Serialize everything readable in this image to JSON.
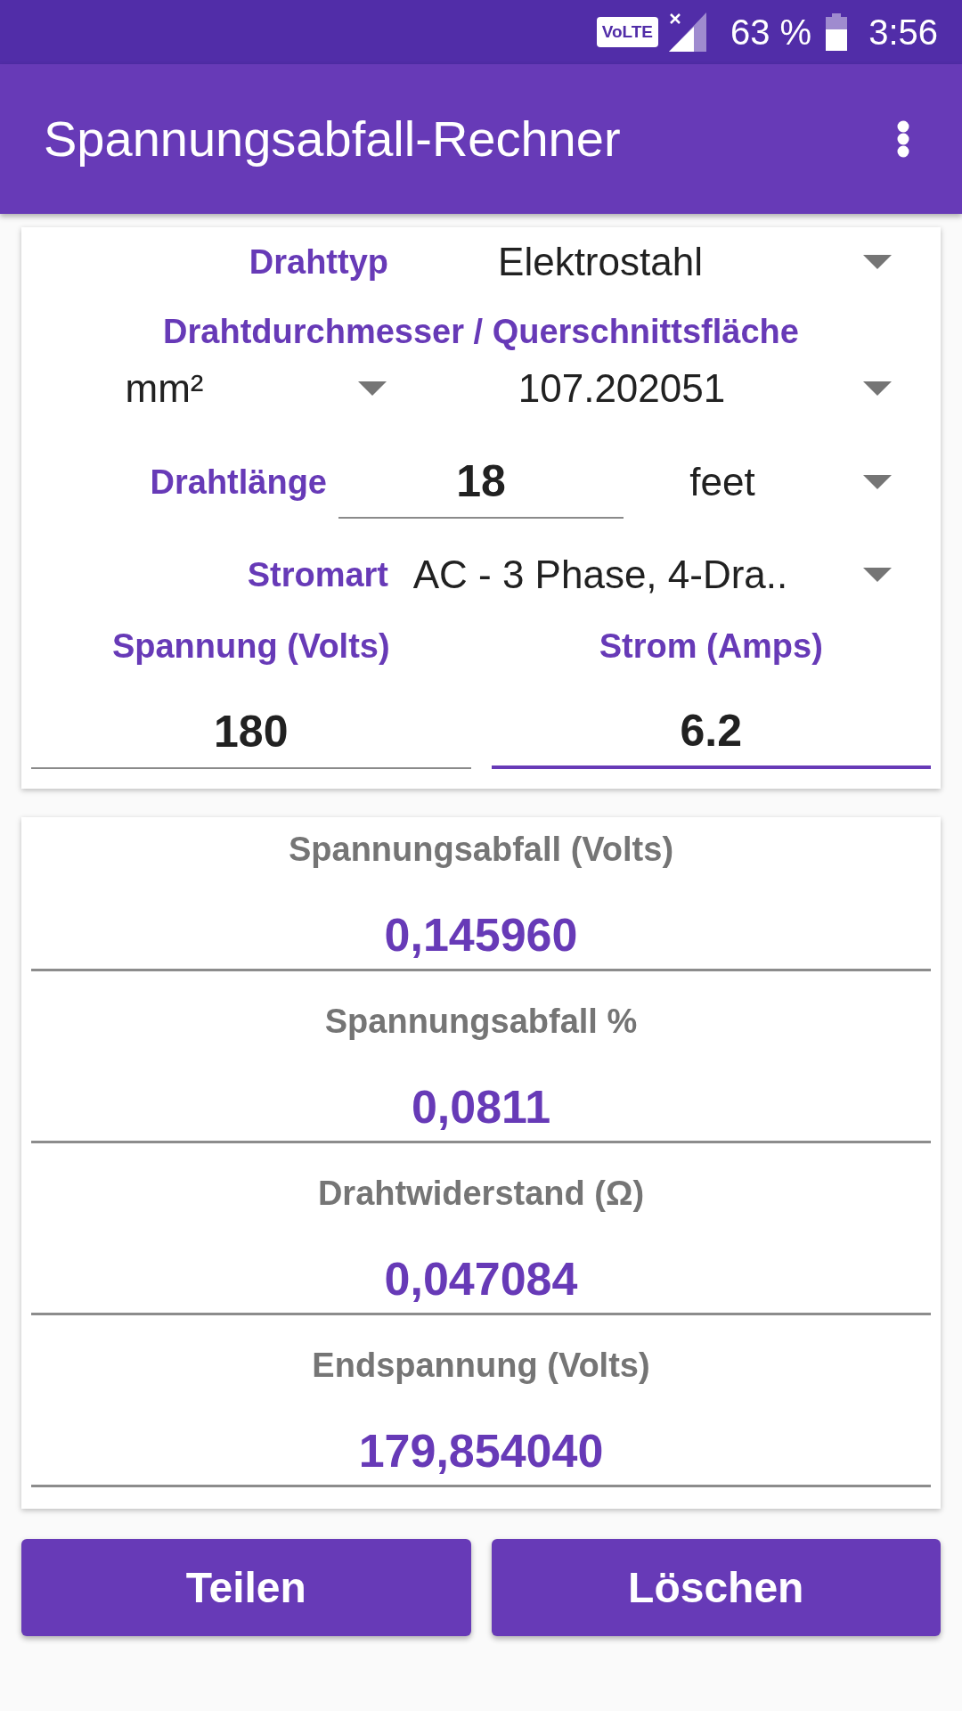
{
  "status_bar": {
    "volte": "VoLTE",
    "battery_percent": "63 %",
    "time": "3:56"
  },
  "app_bar": {
    "title": "Spannungsabfall-Rechner"
  },
  "input_card": {
    "wire_type": {
      "label": "Drahttyp",
      "value": "Elektrostahl"
    },
    "size_heading": "Drahtdurchmesser / Querschnittsfläche",
    "size_unit": {
      "value": "mm²"
    },
    "size_value": {
      "value": "107.202051"
    },
    "length": {
      "label": "Drahtlänge",
      "value": "18",
      "unit": "feet"
    },
    "current_type": {
      "label": "Stromart",
      "value": "AC - 3 Phase, 4-Dra.."
    },
    "voltage": {
      "label": "Spannung (Volts)",
      "value": "180",
      "focused": false
    },
    "current": {
      "label": "Strom (Amps)",
      "value": "6.2",
      "focused": true
    }
  },
  "results": [
    {
      "label": "Spannungsabfall (Volts)",
      "value": "0,145960"
    },
    {
      "label": "Spannungsabfall %",
      "value": "0,0811"
    },
    {
      "label": "Drahtwiderstand (Ω)",
      "value": "0,047084"
    },
    {
      "label": "Endspannung (Volts)",
      "value": "179,854040"
    }
  ],
  "buttons": [
    {
      "label": "Teilen"
    },
    {
      "label": "Löschen"
    }
  ]
}
